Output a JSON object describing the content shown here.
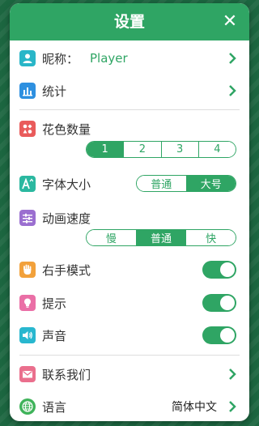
{
  "header": {
    "title": "设置",
    "close_label": "✕"
  },
  "nickname": {
    "label": "昵称：",
    "value": "Player"
  },
  "stats": {
    "label": "统计"
  },
  "suits": {
    "label": "花色数量",
    "options": [
      "1",
      "2",
      "3",
      "4"
    ],
    "selected": "1"
  },
  "font_size": {
    "label": "字体大小",
    "options": [
      "普通",
      "大号"
    ],
    "selected": "大号"
  },
  "anim_speed": {
    "label": "动画速度",
    "options": [
      "慢",
      "普通",
      "快"
    ],
    "selected": "普通"
  },
  "right_hand": {
    "label": "右手模式",
    "on": true
  },
  "hints": {
    "label": "提示",
    "on": true
  },
  "sound": {
    "label": "声音",
    "on": true
  },
  "contact": {
    "label": "联系我们"
  },
  "language": {
    "label": "语言",
    "value": "简体中文"
  },
  "colors": {
    "accent": "#2fa564"
  },
  "icons": {
    "nickname": "person-icon",
    "stats": "bar-chart-icon",
    "suits": "card-suits-icon",
    "font_size": "font-size-icon",
    "anim_speed": "sliders-icon",
    "right_hand": "hand-icon",
    "hints": "lightbulb-icon",
    "sound": "speaker-icon",
    "contact": "envelope-icon",
    "language": "globe-icon"
  }
}
